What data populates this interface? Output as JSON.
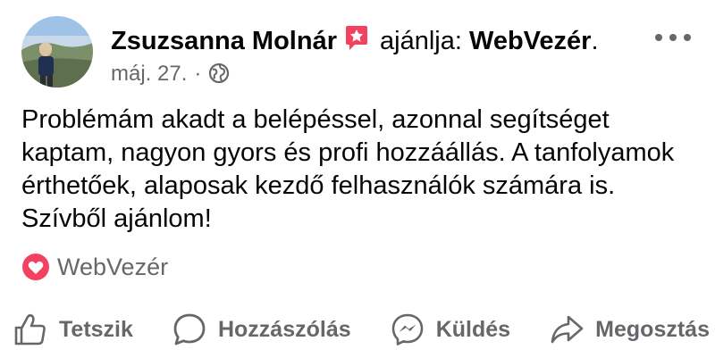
{
  "post": {
    "author": "Zsuzsanna Molnár",
    "verb": "ajánlja:",
    "page": "WebVezér",
    "page_suffix": ".",
    "date": "máj. 27.",
    "separator": "·",
    "icons": {
      "badge": "recommendation-badge-icon",
      "privacy": "globe-icon",
      "more": "more-options-icon"
    },
    "colors": {
      "badge": "#f3425f",
      "heart": "#f3425f",
      "muted": "#65676b"
    },
    "text": "Problémám akadt a belépéssel, azonnal segítséget kaptam, nagyon gyors és profi hozzáállás. A tanfolyamok érthetőek, alaposak kezdő felhasználók számára is. Szívből ajánlom!",
    "recommendation": {
      "icon": "heart-icon",
      "label": "WebVezér"
    }
  },
  "actions": [
    {
      "label": "Tetszik",
      "icon": "thumbs-up-icon"
    },
    {
      "label": "Hozzászólás",
      "icon": "comment-icon"
    },
    {
      "label": "Küldés",
      "icon": "messenger-icon"
    },
    {
      "label": "Megosztás",
      "icon": "share-icon"
    }
  ]
}
